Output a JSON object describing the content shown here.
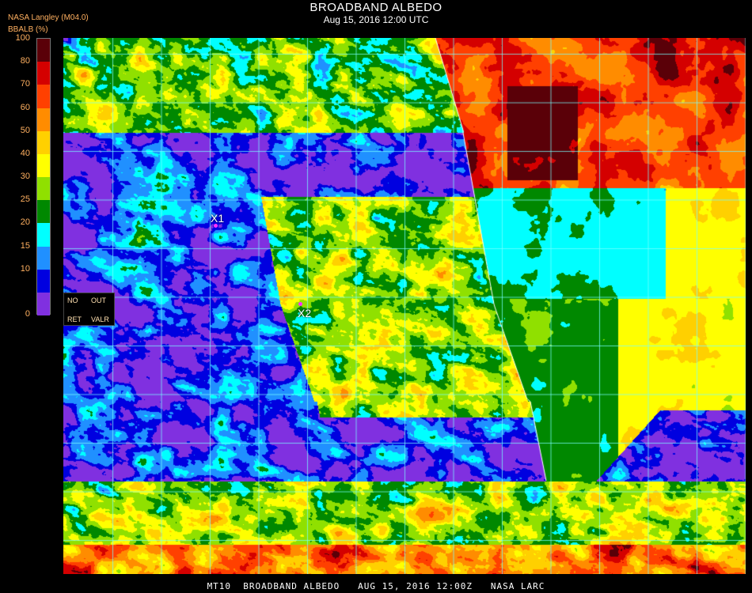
{
  "header": {
    "title": "BROADBAND ALBEDO",
    "subtitle": "Aug 15, 2016 12:00 UTC",
    "source": "NASA Langley (M04.0)",
    "parameter": "BBALB (%)"
  },
  "colorbar": {
    "ticks": [
      "100",
      "80",
      "70",
      "60",
      "50",
      "40",
      "30",
      "25",
      "20",
      "15",
      "10",
      "0"
    ],
    "colors": [
      "#5a0008",
      "#d40000",
      "#ff4000",
      "#ff8c00",
      "#ffd000",
      "#ffff00",
      "#90e000",
      "#008800",
      "#00ffff",
      "#2090ff",
      "#0000e0",
      "#8030e0"
    ]
  },
  "legend": {
    "no": "NO",
    "out": "OUT",
    "ret": "RET",
    "valr": "VALR"
  },
  "markers": [
    {
      "label": "X1"
    },
    {
      "label": "X2"
    }
  ],
  "footer": "MT10  BROADBAND ALBEDO   AUG 15, 2016 12:00Z   NASA LARC"
}
